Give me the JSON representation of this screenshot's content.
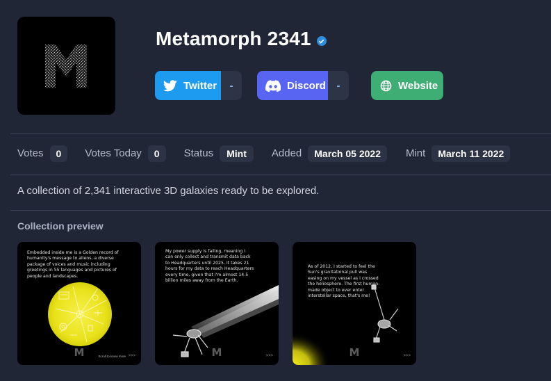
{
  "collection": {
    "name": "Metamorph 2341",
    "logo_letter": "M",
    "description": "A collection of 2,341 interactive 3D galaxies ready to be explored."
  },
  "links": {
    "twitter": {
      "label": "Twitter",
      "extra": "-",
      "icon": "twitter-bird-icon",
      "color": "#1d9bf0"
    },
    "discord": {
      "label": "Discord",
      "extra": "-",
      "icon": "discord-icon",
      "color": "#5865f2"
    },
    "website": {
      "label": "Website",
      "icon": "globe-icon",
      "color": "#3fae74"
    }
  },
  "stats": {
    "votes_label": "Votes",
    "votes": "0",
    "votes_today_label": "Votes Today",
    "votes_today": "0",
    "status_label": "Status",
    "status": "Mint",
    "added_label": "Added",
    "added": "March 05 2022",
    "mint_label": "Mint",
    "mint": "March 11 2022"
  },
  "preview": {
    "title": "Collection preview",
    "cards": [
      {
        "text": "Embedded inside me is a Golden record of humanity's message to aliens, a diverse package of voices and music including greetings in 55 languages and pictures of people and landscapes.",
        "footer": "Scroll to know more",
        "mark": "M",
        "arrows": ">>>"
      },
      {
        "text": "My power supply is failing, meaning I can only collect and transmit data back to Headquarters until 2025. It takes 21 hours for my data to reach Headquarters every time, given that I'm almost 14.5 billion miles away from the Earth.",
        "mark": "M",
        "arrows": ">>>"
      },
      {
        "text": "As of 2012, I started to feel the Sun's gravitational pull was easing on my vessel as I crossed the heliosphere. The first human-made object to ever enter interstellar space, that's me!",
        "mark": "M",
        "arrows": ">>>"
      }
    ]
  },
  "colors": {
    "background": "#202635",
    "chip": "#2b3344",
    "verified": "#2f8dde",
    "golden_record": "#f2ea1e"
  }
}
